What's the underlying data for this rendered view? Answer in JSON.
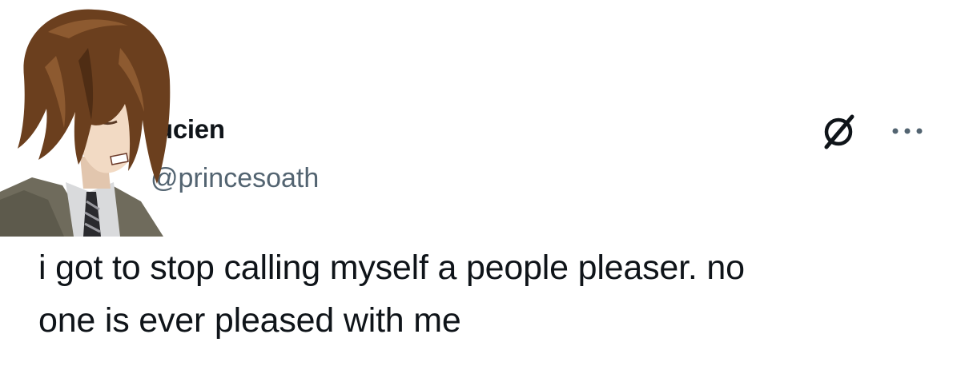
{
  "author": {
    "display_name": "ucien",
    "handle": "@princesoath",
    "avatar_icon": "anime-character-avatar"
  },
  "tweet": {
    "text_line_1": "i got to stop calling myself a people pleaser. no",
    "text_line_2": "one is ever pleased with me"
  },
  "actions": {
    "grok_icon": "grok-icon",
    "more_icon": "more-options-icon"
  },
  "colors": {
    "text_primary": "#0f1419",
    "text_secondary": "#536471",
    "background": "#ffffff"
  }
}
